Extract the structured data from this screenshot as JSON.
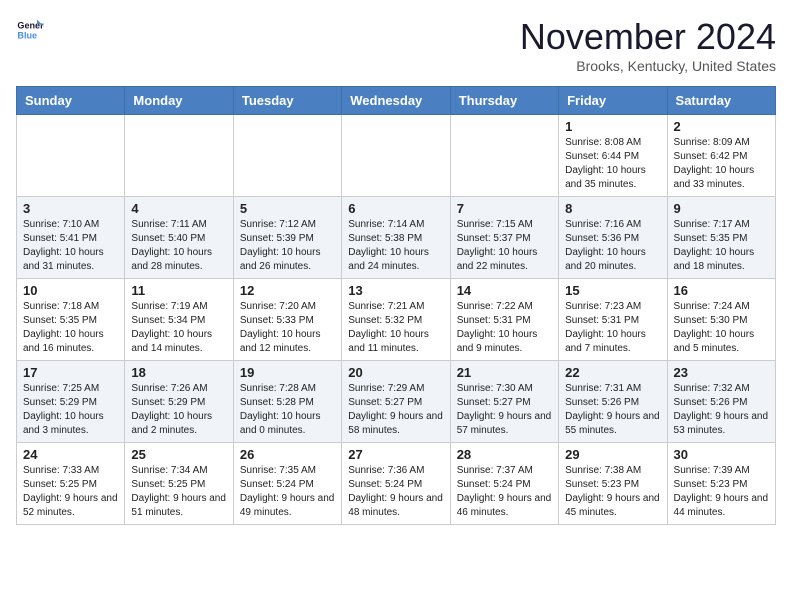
{
  "header": {
    "logo_line1": "General",
    "logo_line2": "Blue",
    "month": "November 2024",
    "location": "Brooks, Kentucky, United States"
  },
  "days_of_week": [
    "Sunday",
    "Monday",
    "Tuesday",
    "Wednesday",
    "Thursday",
    "Friday",
    "Saturday"
  ],
  "weeks": [
    [
      {
        "day": "",
        "info": ""
      },
      {
        "day": "",
        "info": ""
      },
      {
        "day": "",
        "info": ""
      },
      {
        "day": "",
        "info": ""
      },
      {
        "day": "",
        "info": ""
      },
      {
        "day": "1",
        "info": "Sunrise: 8:08 AM\nSunset: 6:44 PM\nDaylight: 10 hours and 35 minutes."
      },
      {
        "day": "2",
        "info": "Sunrise: 8:09 AM\nSunset: 6:42 PM\nDaylight: 10 hours and 33 minutes."
      }
    ],
    [
      {
        "day": "3",
        "info": "Sunrise: 7:10 AM\nSunset: 5:41 PM\nDaylight: 10 hours and 31 minutes."
      },
      {
        "day": "4",
        "info": "Sunrise: 7:11 AM\nSunset: 5:40 PM\nDaylight: 10 hours and 28 minutes."
      },
      {
        "day": "5",
        "info": "Sunrise: 7:12 AM\nSunset: 5:39 PM\nDaylight: 10 hours and 26 minutes."
      },
      {
        "day": "6",
        "info": "Sunrise: 7:14 AM\nSunset: 5:38 PM\nDaylight: 10 hours and 24 minutes."
      },
      {
        "day": "7",
        "info": "Sunrise: 7:15 AM\nSunset: 5:37 PM\nDaylight: 10 hours and 22 minutes."
      },
      {
        "day": "8",
        "info": "Sunrise: 7:16 AM\nSunset: 5:36 PM\nDaylight: 10 hours and 20 minutes."
      },
      {
        "day": "9",
        "info": "Sunrise: 7:17 AM\nSunset: 5:35 PM\nDaylight: 10 hours and 18 minutes."
      }
    ],
    [
      {
        "day": "10",
        "info": "Sunrise: 7:18 AM\nSunset: 5:35 PM\nDaylight: 10 hours and 16 minutes."
      },
      {
        "day": "11",
        "info": "Sunrise: 7:19 AM\nSunset: 5:34 PM\nDaylight: 10 hours and 14 minutes."
      },
      {
        "day": "12",
        "info": "Sunrise: 7:20 AM\nSunset: 5:33 PM\nDaylight: 10 hours and 12 minutes."
      },
      {
        "day": "13",
        "info": "Sunrise: 7:21 AM\nSunset: 5:32 PM\nDaylight: 10 hours and 11 minutes."
      },
      {
        "day": "14",
        "info": "Sunrise: 7:22 AM\nSunset: 5:31 PM\nDaylight: 10 hours and 9 minutes."
      },
      {
        "day": "15",
        "info": "Sunrise: 7:23 AM\nSunset: 5:31 PM\nDaylight: 10 hours and 7 minutes."
      },
      {
        "day": "16",
        "info": "Sunrise: 7:24 AM\nSunset: 5:30 PM\nDaylight: 10 hours and 5 minutes."
      }
    ],
    [
      {
        "day": "17",
        "info": "Sunrise: 7:25 AM\nSunset: 5:29 PM\nDaylight: 10 hours and 3 minutes."
      },
      {
        "day": "18",
        "info": "Sunrise: 7:26 AM\nSunset: 5:29 PM\nDaylight: 10 hours and 2 minutes."
      },
      {
        "day": "19",
        "info": "Sunrise: 7:28 AM\nSunset: 5:28 PM\nDaylight: 10 hours and 0 minutes."
      },
      {
        "day": "20",
        "info": "Sunrise: 7:29 AM\nSunset: 5:27 PM\nDaylight: 9 hours and 58 minutes."
      },
      {
        "day": "21",
        "info": "Sunrise: 7:30 AM\nSunset: 5:27 PM\nDaylight: 9 hours and 57 minutes."
      },
      {
        "day": "22",
        "info": "Sunrise: 7:31 AM\nSunset: 5:26 PM\nDaylight: 9 hours and 55 minutes."
      },
      {
        "day": "23",
        "info": "Sunrise: 7:32 AM\nSunset: 5:26 PM\nDaylight: 9 hours and 53 minutes."
      }
    ],
    [
      {
        "day": "24",
        "info": "Sunrise: 7:33 AM\nSunset: 5:25 PM\nDaylight: 9 hours and 52 minutes."
      },
      {
        "day": "25",
        "info": "Sunrise: 7:34 AM\nSunset: 5:25 PM\nDaylight: 9 hours and 51 minutes."
      },
      {
        "day": "26",
        "info": "Sunrise: 7:35 AM\nSunset: 5:24 PM\nDaylight: 9 hours and 49 minutes."
      },
      {
        "day": "27",
        "info": "Sunrise: 7:36 AM\nSunset: 5:24 PM\nDaylight: 9 hours and 48 minutes."
      },
      {
        "day": "28",
        "info": "Sunrise: 7:37 AM\nSunset: 5:24 PM\nDaylight: 9 hours and 46 minutes."
      },
      {
        "day": "29",
        "info": "Sunrise: 7:38 AM\nSunset: 5:23 PM\nDaylight: 9 hours and 45 minutes."
      },
      {
        "day": "30",
        "info": "Sunrise: 7:39 AM\nSunset: 5:23 PM\nDaylight: 9 hours and 44 minutes."
      }
    ]
  ]
}
